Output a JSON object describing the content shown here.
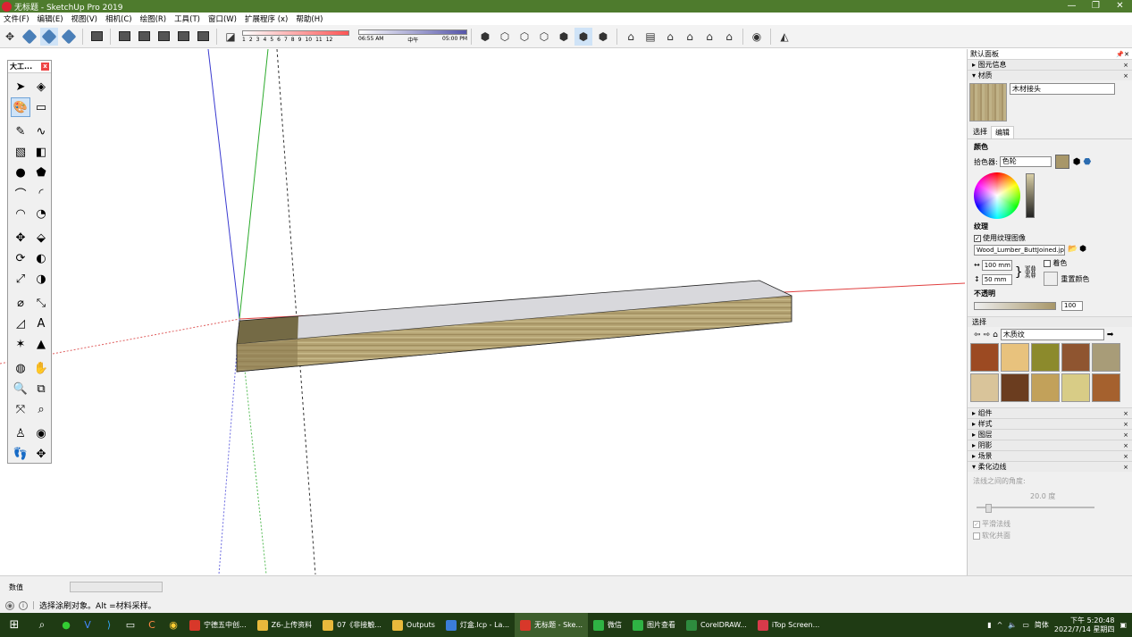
{
  "window": {
    "title": "无标题 - SketchUp Pro 2019",
    "minimize": "—",
    "restore": "❐",
    "close": "✕"
  },
  "menu": [
    "文件(F)",
    "编辑(E)",
    "视图(V)",
    "相机(C)",
    "绘图(R)",
    "工具(T)",
    "窗口(W)",
    "扩展程序 (x)",
    "帮助(H)"
  ],
  "shadows": {
    "months": [
      "1",
      "2",
      "3",
      "4",
      "5",
      "6",
      "7",
      "8",
      "9",
      "10",
      "11",
      "12"
    ],
    "time_start": "06:55 AM",
    "time_mid": "中午",
    "time_end": "05:00 PM"
  },
  "palette": {
    "title": "大工..."
  },
  "panel": {
    "title": "默认面板",
    "entity_info": "图元信息",
    "materials": "材质",
    "material_name": "木材接头",
    "tab_select": "选择",
    "tab_edit": "编辑",
    "color_label": "颜色",
    "picker_label": "拾色器:",
    "picker_value": "色轮",
    "texture_label": "纹理",
    "use_texture": "使用纹理图像",
    "texture_file": "Wood_Lumber_ButtJoined.jpg",
    "width": "100 mm",
    "height": "50 mm",
    "colorize": "着色",
    "reset_color": "重置颜色",
    "opacity_label": "不透明",
    "opacity_value": "100",
    "select_label": "选择",
    "library": "木质纹",
    "trays": [
      "组件",
      "样式",
      "图层",
      "阴影",
      "场景"
    ],
    "soften": "柔化边线",
    "soften_angle_label": "法线之间的角度:",
    "soften_angle": "20.0  度",
    "smooth_normals": "平滑法线",
    "soften_coplanar": "软化共面"
  },
  "swatch_colors": [
    "#9c4a22",
    "#e8c27d",
    "#8c8a2c",
    "#8f5530",
    "#a89c78",
    "#d9c49a",
    "#6b3d1f",
    "#c2a15a",
    "#d8cc86",
    "#a5612e"
  ],
  "measure_label": "数值",
  "status_text": "选择涂刷对象。Alt =材料采样。",
  "taskbar": {
    "tasks": [
      {
        "label": "宁德五中创...",
        "color": "#d8382a"
      },
      {
        "label": "Z6-上传资料",
        "color": "#e8b93c"
      },
      {
        "label": "07《非接触...",
        "color": "#e8b93c"
      },
      {
        "label": "Outputs",
        "color": "#e8b93c"
      },
      {
        "label": "灯盒.lcp - La...",
        "color": "#3b7dd8"
      },
      {
        "label": "无标题 - Ske...",
        "color": "#d8382a"
      },
      {
        "label": "微信",
        "color": "#2fb344"
      },
      {
        "label": "图片查看",
        "color": "#2fb344"
      },
      {
        "label": "CorelDRAW...",
        "color": "#2e8b3e"
      },
      {
        "label": "iTop Screen...",
        "color": "#d83a4a"
      }
    ],
    "ime": "简体",
    "time": "下午 5:20:48",
    "date": "2022/7/14 星期四"
  }
}
